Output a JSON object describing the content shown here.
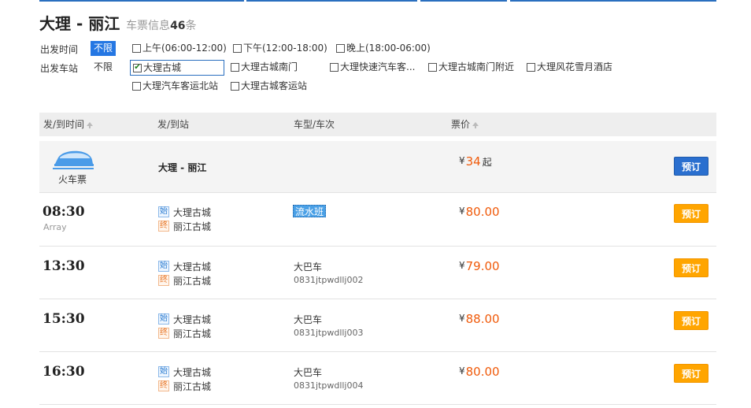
{
  "header": {
    "route": "大理 - 丽江",
    "info_label": "车票信息",
    "count": "46",
    "count_unit": "条"
  },
  "filters": {
    "time": {
      "label": "出发时间",
      "no_limit": "不限",
      "options": [
        "上午(06:00-12:00)",
        "下午(12:00-18:00)",
        "晚上(18:00-06:00)"
      ]
    },
    "station": {
      "label": "出发车站",
      "no_limit": "不限",
      "options": [
        "大理古城",
        "大理古城南门",
        "大理快速汽车客...",
        "大理古城南门附近",
        "大理风花雪月酒店",
        "大理汽车客运北站",
        "大理古城客运站"
      ],
      "selected": "大理古城",
      "check_mark": "✔"
    }
  },
  "table": {
    "headers": {
      "time": "发/到时间",
      "station": "发/到站",
      "type": "车型/车次",
      "price": "票价"
    }
  },
  "train": {
    "label": "火车票",
    "route": "大理 - 丽江",
    "currency": "¥",
    "price": "34",
    "price_suffix": "起",
    "button": "预订"
  },
  "badges": {
    "start": "始",
    "end": "终"
  },
  "rows": [
    {
      "time": "08:30",
      "sub": "Array",
      "from": "大理古城",
      "to": "丽江古城",
      "type_tag": "流水班",
      "currency": "¥",
      "price": "80.00",
      "button": "预订"
    },
    {
      "time": "13:30",
      "from": "大理古城",
      "to": "丽江古城",
      "type": "大巴车",
      "code": "0831jtpwdllj002",
      "currency": "¥",
      "price": "79.00",
      "button": "预订"
    },
    {
      "time": "15:30",
      "from": "大理古城",
      "to": "丽江古城",
      "type": "大巴车",
      "code": "0831jtpwdllj003",
      "currency": "¥",
      "price": "88.00",
      "button": "预订"
    },
    {
      "time": "16:30",
      "from": "大理古城",
      "to": "丽江古城",
      "type": "大巴车",
      "code": "0831jtpwdllj004",
      "currency": "¥",
      "price": "80.00",
      "button": "预订"
    }
  ],
  "colors": {
    "accent_blue": "#2577e3",
    "price_orange": "#f05a0a",
    "book_button": "#ffa500"
  }
}
